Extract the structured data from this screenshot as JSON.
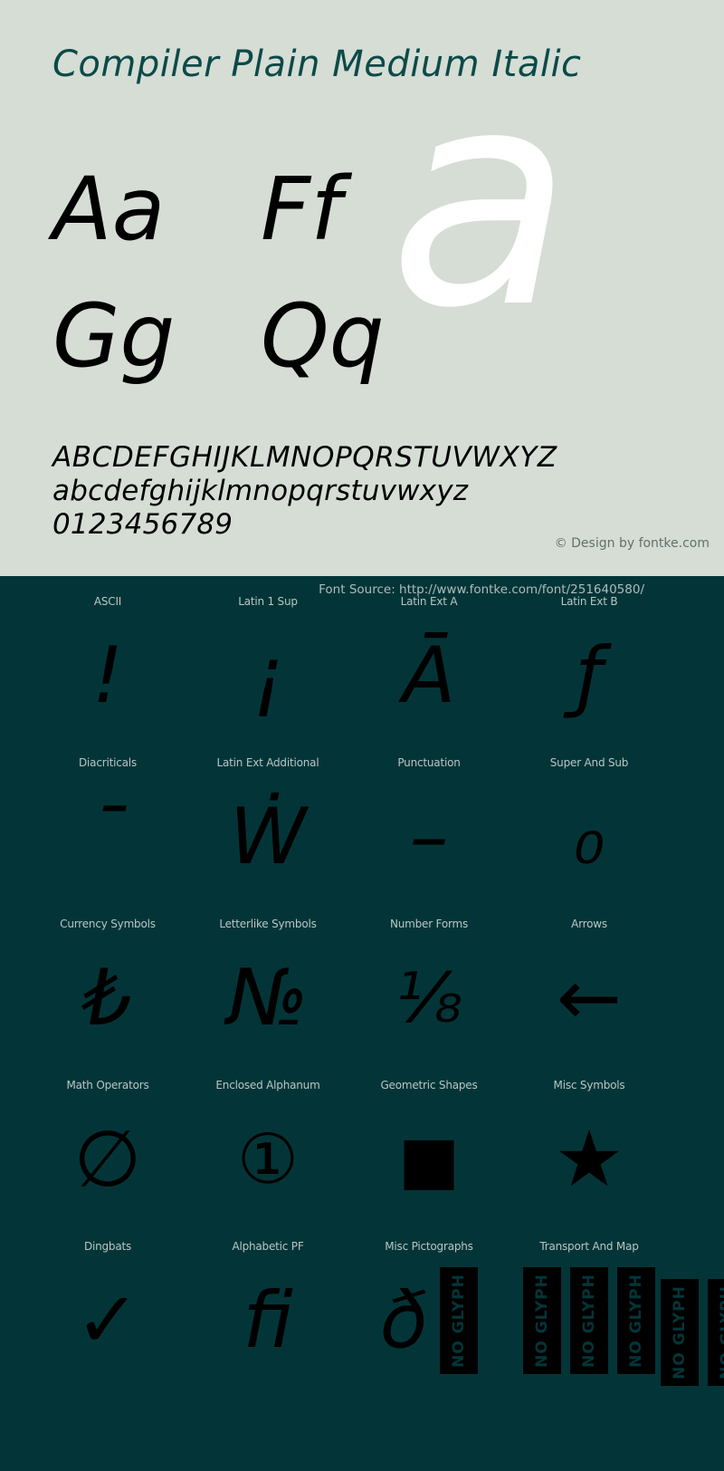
{
  "specimen": {
    "title": "Compiler Plain Medium Italic",
    "watermark_letter": "a",
    "hero_pairs": [
      {
        "upper": "A",
        "lower": "a",
        "pair": "Aa"
      },
      {
        "upper": "F",
        "lower": "f",
        "pair": "Ff"
      },
      {
        "upper": "G",
        "lower": "g",
        "pair": "Gg"
      },
      {
        "upper": "Q",
        "lower": "q",
        "pair": "Qq"
      }
    ],
    "alphabet_uppercase": "ABCDEFGHIJKLMNOPQRSTUVWXYZ",
    "alphabet_lowercase": "abcdefghijklmnopqrstuvwxyz",
    "numerals": "0123456789",
    "credit": "© Design by fontke.com",
    "font_source": "Font Source: http://www.fontke.com/font/251640580/"
  },
  "colors": {
    "top_background": "#d5ddd5",
    "bottom_background": "#033538",
    "title_color": "#0c4a48",
    "glyph_color": "#000000",
    "watermark_color": "#ffffff",
    "label_color": "#b9c6c3",
    "credit_color": "#63706b",
    "source_color": "#aebcba"
  },
  "unicode_blocks": {
    "rows": [
      [
        {
          "label": "ASCII",
          "sample": "!",
          "no_glyph_count": 0
        },
        {
          "label": "Latin 1 Sup",
          "sample": "¡",
          "no_glyph_count": 0
        },
        {
          "label": "Latin Ext A",
          "sample": "Ā",
          "no_glyph_count": 0
        },
        {
          "label": "Latin Ext B",
          "sample": "ƒ",
          "no_glyph_count": 0
        }
      ],
      [
        {
          "label": "Diacriticals",
          "sample": "ˉ",
          "no_glyph_count": 0
        },
        {
          "label": "Latin Ext Additional",
          "sample": "Ẇ",
          "no_glyph_count": 0
        },
        {
          "label": "Punctuation",
          "sample": "–",
          "no_glyph_count": 0
        },
        {
          "label": "Super And Sub",
          "sample": "₀",
          "no_glyph_count": 0
        }
      ],
      [
        {
          "label": "Currency Symbols",
          "sample": "₺",
          "no_glyph_count": 0
        },
        {
          "label": "Letterlike Symbols",
          "sample": "№",
          "no_glyph_count": 0
        },
        {
          "label": "Number Forms",
          "sample": "⅛",
          "no_glyph_count": 0
        },
        {
          "label": "Arrows",
          "sample": "←",
          "no_glyph_count": 0
        }
      ],
      [
        {
          "label": "Math Operators",
          "sample": "∅",
          "no_glyph_count": 0
        },
        {
          "label": "Enclosed Alphanum",
          "sample": "①",
          "no_glyph_count": 0
        },
        {
          "label": "Geometric Shapes",
          "sample": "■",
          "no_glyph_count": 0
        },
        {
          "label": "Misc Symbols",
          "sample": "★",
          "no_glyph_count": 0
        }
      ],
      [
        {
          "label": "Dingbats",
          "sample": "✓",
          "no_glyph_count": 0
        },
        {
          "label": "Alphabetic PF",
          "sample": "ﬁ",
          "no_glyph_count": 0
        },
        {
          "label": "Misc Pictographs",
          "sample": "ð",
          "no_glyph_count": 1
        },
        {
          "label": "Transport And Map",
          "sample": "",
          "no_glyph_count": 3
        }
      ]
    ],
    "no_glyph_label": "NO GLYPH"
  }
}
